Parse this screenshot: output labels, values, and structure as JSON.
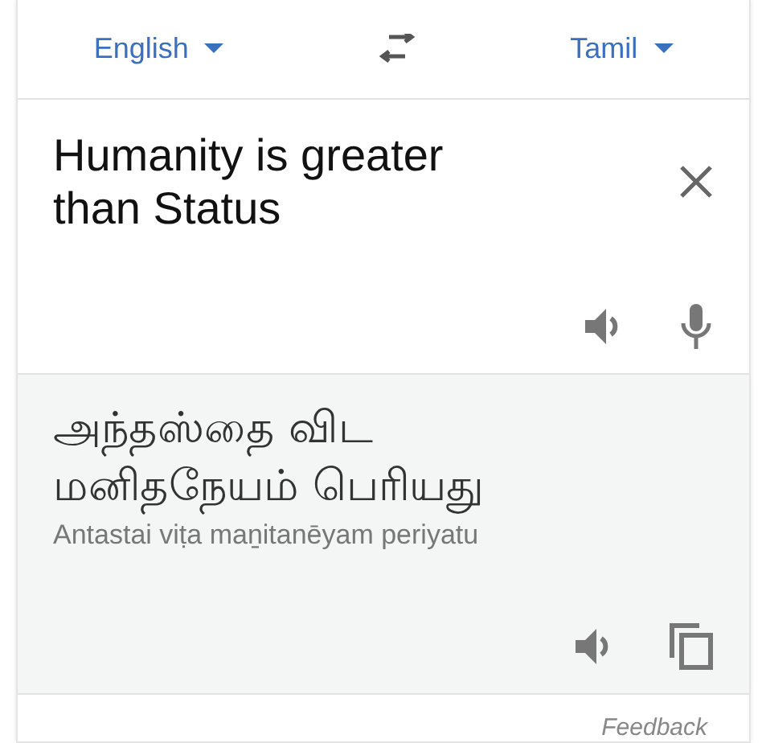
{
  "language_bar": {
    "source_language": "English",
    "target_language": "Tamil"
  },
  "source": {
    "text": "Humanity is greater than Status"
  },
  "translation": {
    "text": "அந்தஸ்தை விட மனிதநேயம் பெரியது",
    "transliteration": "Antastai viṭa maṉitanēyam periyatu"
  },
  "footer": {
    "link": "Feedback"
  }
}
